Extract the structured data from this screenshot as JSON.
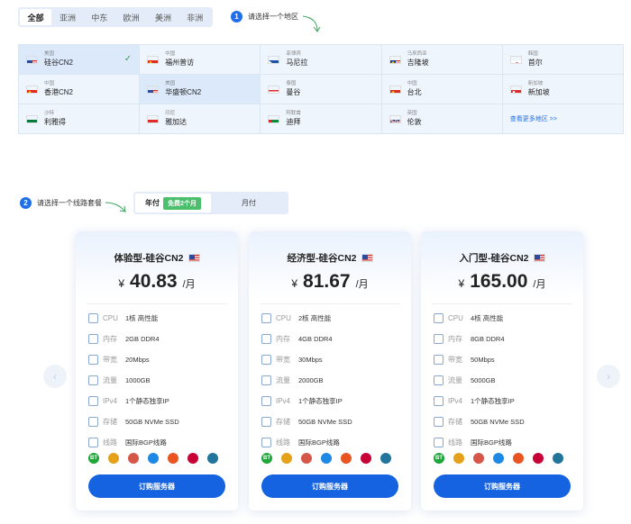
{
  "region_tabs": [
    "全部",
    "亚洲",
    "中东",
    "欧洲",
    "美洲",
    "非洲"
  ],
  "step1": {
    "num": "1",
    "text": "请选择一个地区"
  },
  "step2": {
    "num": "2",
    "text": "请选择一个线路套餐"
  },
  "locations": [
    {
      "country": "美国",
      "city": "硅谷CN2",
      "flag": "us",
      "state": "checked"
    },
    {
      "country": "中国",
      "city": "福州普访",
      "flag": "cn"
    },
    {
      "country": "菲律宾",
      "city": "马尼拉",
      "flag": "ph"
    },
    {
      "country": "马来西亚",
      "city": "吉隆坡",
      "flag": "my"
    },
    {
      "country": "韩国",
      "city": "首尔",
      "flag": "kr"
    },
    {
      "country": "中国",
      "city": "香港CN2",
      "flag": "cn"
    },
    {
      "country": "美国",
      "city": "华盛顿CN2",
      "flag": "us",
      "state": "selected"
    },
    {
      "country": "泰国",
      "city": "曼谷",
      "flag": "th"
    },
    {
      "country": "中国",
      "city": "台北",
      "flag": "cn"
    },
    {
      "country": "新加坡",
      "city": "新加坡",
      "flag": "sg"
    },
    {
      "country": "沙特",
      "city": "利雅得",
      "flag": "sa"
    },
    {
      "country": "印尼",
      "city": "雅加达",
      "flag": "id"
    },
    {
      "country": "阿联酋",
      "city": "迪拜",
      "flag": "ae"
    },
    {
      "country": "英国",
      "city": "伦敦",
      "flag": "gb"
    }
  ],
  "more_link": "查看更多地区 >>",
  "check_mark": "✓",
  "billing": {
    "yearly": "年付",
    "badge": "免费2个月",
    "monthly": "月付"
  },
  "spec_labels": [
    "CPU",
    "内存",
    "带宽",
    "流量",
    "IPv4",
    "存储",
    "线路"
  ],
  "plans": [
    {
      "title": "体验型-硅谷CN2",
      "currency": "¥",
      "price": "40.83",
      "per": "/月",
      "specs": [
        "1核 高性能",
        "2GB DDR4",
        "20Mbps",
        "1000GB",
        "1个静态独享IP",
        "50GB NVMe SSD",
        "国际BGP线路"
      ],
      "button": "订购服务器"
    },
    {
      "title": "经济型-硅谷CN2",
      "currency": "¥",
      "price": "81.67",
      "per": "/月",
      "specs": [
        "2核 高性能",
        "4GB DDR4",
        "30Mbps",
        "2000GB",
        "1个静态独享IP",
        "50GB NVMe SSD",
        "国际BGP线路"
      ],
      "button": "订购服务器"
    },
    {
      "title": "入门型-硅谷CN2",
      "currency": "¥",
      "price": "165.00",
      "per": "/月",
      "specs": [
        "4核 高性能",
        "8GB DDR4",
        "50Mbps",
        "5000GB",
        "1个静态独享IP",
        "50GB NVMe SSD",
        "国际BGP线路"
      ],
      "button": "订购服务器"
    }
  ],
  "os_icons": [
    {
      "name": "bt-panel-icon",
      "label": "BT",
      "color": "#20a53a"
    },
    {
      "name": "settings-icon",
      "label": "",
      "color": "#e5a11a"
    },
    {
      "name": "nodisplay-icon",
      "label": "",
      "color": "#d6564a"
    },
    {
      "name": "windows-icon",
      "label": "",
      "color": "#1e88e5"
    },
    {
      "name": "ubuntu-icon",
      "label": "",
      "color": "#e95420"
    },
    {
      "name": "debian-icon",
      "label": "",
      "color": "#c70036"
    },
    {
      "name": "wordpress-icon",
      "label": "",
      "color": "#21759b"
    }
  ],
  "nav": {
    "prev": "‹",
    "next": "›"
  }
}
